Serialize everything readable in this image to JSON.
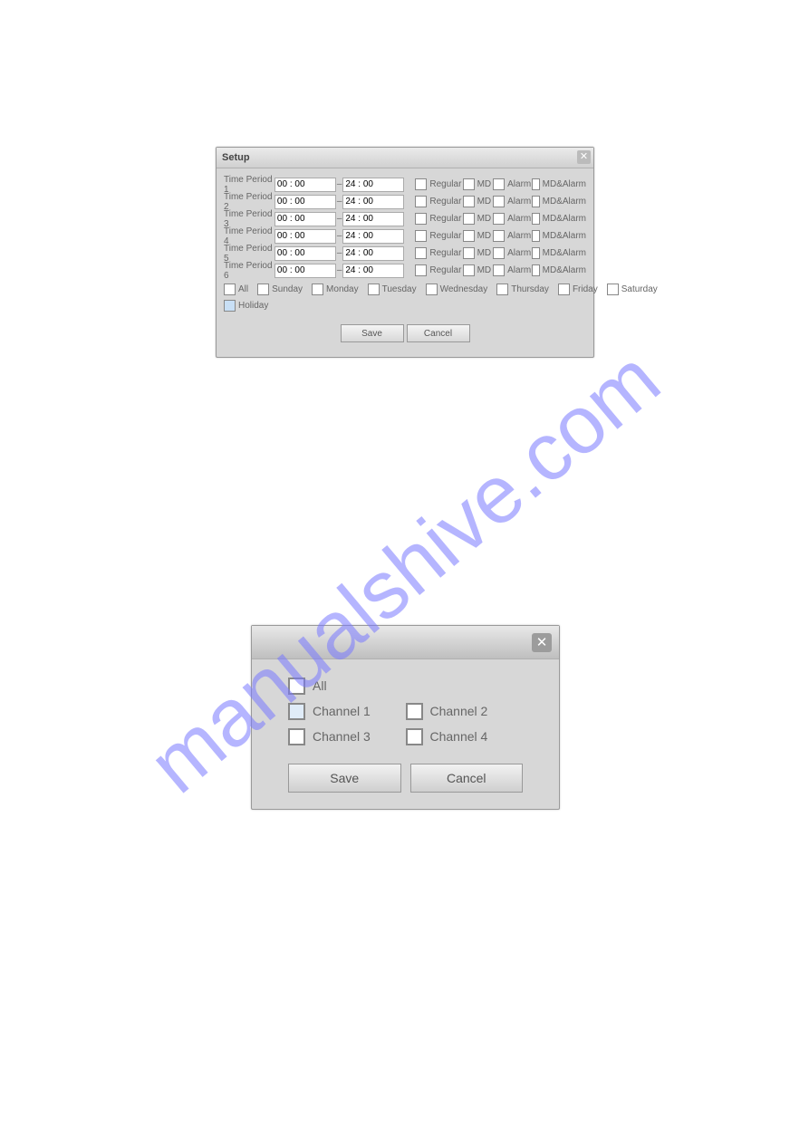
{
  "watermark": "manualshive.com",
  "dialog1": {
    "title": "Setup",
    "periods": [
      {
        "label": "Time Period 1",
        "start": "00 : 00",
        "end": "24 : 00"
      },
      {
        "label": "Time Period 2",
        "start": "00 : 00",
        "end": "24 : 00"
      },
      {
        "label": "Time Period 3",
        "start": "00 : 00",
        "end": "24 : 00"
      },
      {
        "label": "Time Period 4",
        "start": "00 : 00",
        "end": "24 : 00"
      },
      {
        "label": "Time Period 5",
        "start": "00 : 00",
        "end": "24 : 00"
      },
      {
        "label": "Time Period 6",
        "start": "00 : 00",
        "end": "24 : 00"
      }
    ],
    "type_labels": {
      "regular": "Regular",
      "md": "MD",
      "alarm": "Alarm",
      "mdalarm": "MD&Alarm"
    },
    "days": {
      "all": "All",
      "sunday": "Sunday",
      "monday": "Monday",
      "tuesday": "Tuesday",
      "wednesday": "Wednesday",
      "thursday": "Thursday",
      "friday": "Friday",
      "saturday": "Saturday"
    },
    "holiday": "Holiday",
    "save": "Save",
    "cancel": "Cancel"
  },
  "dialog2": {
    "all": "All",
    "channels": [
      "Channel 1",
      "Channel 2",
      "Channel 3",
      "Channel 4"
    ],
    "channel1_checked": true,
    "save": "Save",
    "cancel": "Cancel"
  }
}
